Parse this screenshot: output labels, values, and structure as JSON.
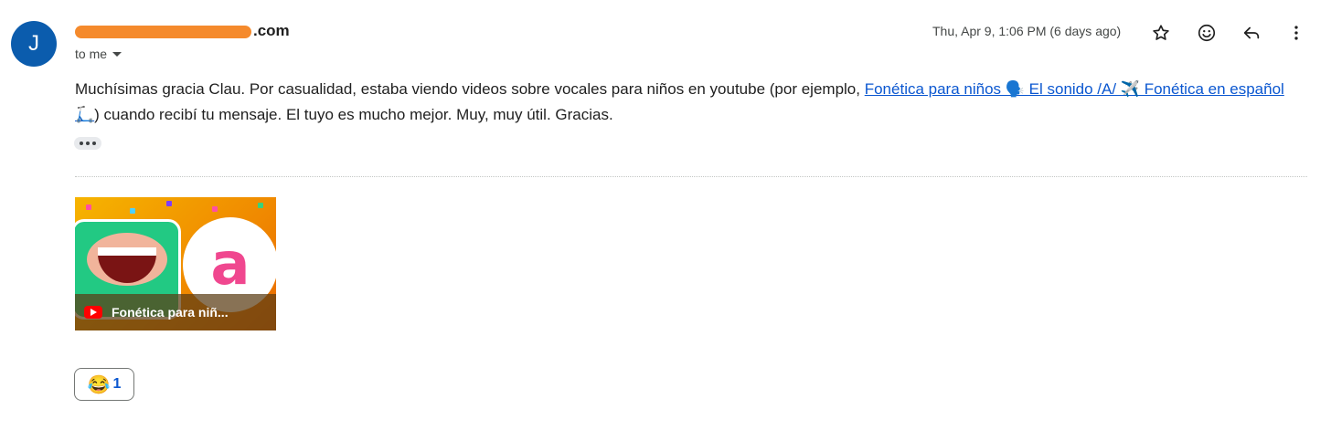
{
  "sender": {
    "avatar_letter": "J",
    "email_visible_suffix": ".com",
    "recipient_label": "to me"
  },
  "date": "Thu, Apr 9, 1:06 PM (6 days ago)",
  "toolbar": {
    "star_icon": "star-icon",
    "emoji_icon": "emoji-reaction-icon",
    "reply_icon": "reply-icon",
    "more_icon": "more-vert-icon"
  },
  "message": {
    "text_before_link": "Muchísimas gracia Clau. Por casualidad, estaba viendo videos sobre vocales para niños en youtube (por ejemplo, ",
    "link_text": "Fonética para niños 🗣️ El sonido /A/ ✈️ Fonética en español 🛴",
    "text_after_link": ") cuando recibí tu mensaje. El tuyo es mucho mejor. Muy, muy útil. Gracias."
  },
  "attachment": {
    "letter": "a",
    "title": "Fonética para niñ..."
  },
  "reaction": {
    "emoji": "😂",
    "count": "1"
  },
  "colors": {
    "avatar": "#0b5cad",
    "link": "#0b57d0",
    "redaction": "#f58a2c"
  }
}
